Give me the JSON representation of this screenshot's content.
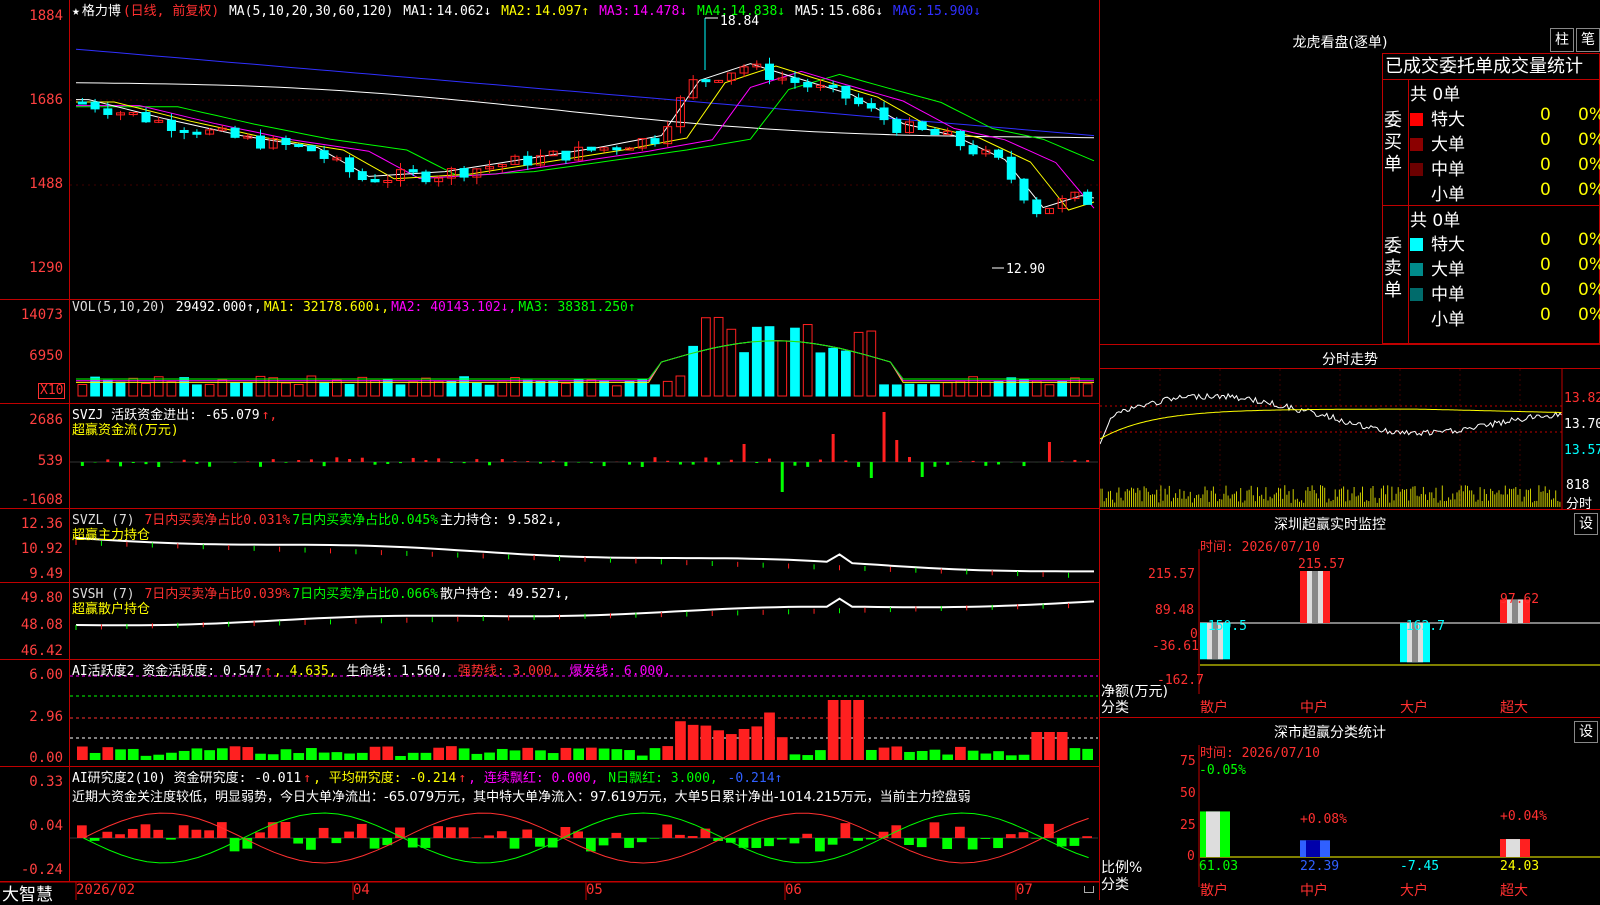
{
  "app_brand": "大智慧",
  "main_chart": {
    "stock": "格力博",
    "period": "(日线, 前复权)",
    "ma_params": "MA(5,10,20,30,60,120)",
    "ma": [
      {
        "label": "MA1:",
        "value": "14.062↓",
        "color": "#ffffff"
      },
      {
        "label": "MA2:",
        "value": "14.097↑",
        "color": "#ffff00"
      },
      {
        "label": "MA3:",
        "value": "14.478↓",
        "color": "#ff00ff"
      },
      {
        "label": "MA4:",
        "value": "14.838↓",
        "color": "#00ff00"
      },
      {
        "label": "MA5:",
        "value": "15.686↓",
        "color": "#ffffff"
      },
      {
        "label": "MA6:",
        "value": "15.900↓",
        "color": "#3030ff"
      }
    ],
    "y_ticks": [
      "1884",
      "1686",
      "1488",
      "1290"
    ],
    "high_label": "18.84",
    "low_label": "12.90"
  },
  "vol_panel": {
    "legend": [
      {
        "text": "VOL(5,10,20)",
        "color": "#ddd"
      },
      {
        "text": " 29492.000↑,",
        "color": "#fff"
      },
      {
        "text": "MA1: 32178.600↓,",
        "color": "#ffff00"
      },
      {
        "text": "MA2: 40143.102↓,",
        "color": "#ff00ff"
      },
      {
        "text": "MA3: 38381.250↑",
        "color": "#00ff00"
      }
    ],
    "y_ticks": [
      "14073",
      "6950"
    ],
    "unit": "X10"
  },
  "svzj_panel": {
    "legend1": [
      {
        "text": "SVZJ  活跃资金进出: -65.079",
        "color": "#fff"
      },
      {
        "text": "↑,",
        "color": "#ff3030"
      }
    ],
    "legend2": "超赢资金流(万元)",
    "y_ticks": [
      "2686",
      "539",
      "-1608"
    ]
  },
  "svzl_panel": {
    "legend1": [
      {
        "text": "SVZL (7) ",
        "color": "#ddd"
      },
      {
        "text": "7日内买卖净占比0.031%",
        "color": "#ff3030"
      },
      {
        "text": "7日内买卖净占比0.045%",
        "color": "#00ff00"
      },
      {
        "text": "主力持仓: 9.582↓,",
        "color": "#fff"
      }
    ],
    "legend2": "超赢主力持仓",
    "y_ticks": [
      "12.36",
      "10.92",
      "9.49"
    ]
  },
  "svsh_panel": {
    "legend1": [
      {
        "text": "SVSH (7) ",
        "color": "#ddd"
      },
      {
        "text": "7日内买卖净占比0.039%",
        "color": "#ff3030"
      },
      {
        "text": "7日内买卖净占比0.066%",
        "color": "#00ff00"
      },
      {
        "text": "散户持仓: 49.527↓,",
        "color": "#fff"
      }
    ],
    "legend2": "超赢散户持仓",
    "y_ticks": [
      "49.80",
      "48.08",
      "46.42"
    ]
  },
  "ai_active_panel": {
    "legend": [
      {
        "text": "AI活跃度2 资金活跃度: 0.547",
        "color": "#fff"
      },
      {
        "text": "↑",
        "color": "#ff3030"
      },
      {
        "text": ", 4.635,",
        "color": "#ffff00"
      },
      {
        "text": " 生命线: 1.560,",
        "color": "#fff"
      },
      {
        "text": " 强势线: 3.000,",
        "color": "#ff3030"
      },
      {
        "text": " 爆发线: 6.000,",
        "color": "#ff00ff"
      }
    ],
    "y_ticks": [
      "6.00",
      "2.96",
      "0.00"
    ]
  },
  "ai_research_panel": {
    "legend": [
      {
        "text": "AI研究度2(10) 资金研究度: -0.011",
        "color": "#fff"
      },
      {
        "text": "↑",
        "color": "#ff3030"
      },
      {
        "text": ", 平均研究度: -0.214",
        "color": "#ffff00"
      },
      {
        "text": "↑",
        "color": "#ff3030"
      },
      {
        "text": ", 连续飘红: 0.000,",
        "color": "#ff00ff"
      },
      {
        "text": " N日飘红: 3.000,",
        "color": "#00ff00"
      },
      {
        "text": " -0.214↑",
        "color": "#3060ff"
      }
    ],
    "commentary": "近期大资金关注度较低，明显弱势，今日大单净流出：-65.079万元，其中特大单净流入：97.619万元，大单5日累计净出-1014.215万元，当前主力控盘弱",
    "y_ticks": [
      "0.33",
      "0.04",
      "-0.24"
    ]
  },
  "date_axis": [
    "2026/02",
    "04",
    "05",
    "06",
    "07"
  ],
  "dragon_tiger": {
    "title": "龙虎看盘(逐单)",
    "btn_bar": "柱",
    "btn_pen": "笔",
    "tabs": "已成交委托单成交量统计",
    "buy": {
      "label": "委买单",
      "total": "共 0单",
      "rows": [
        {
          "name": "特大",
          "color": "#ff0000",
          "count": "0",
          "pct": "0%"
        },
        {
          "name": "大单",
          "color": "#8b0000",
          "count": "0",
          "pct": "0%"
        },
        {
          "name": "中单",
          "color": "#6b0000",
          "count": "0",
          "pct": "0%"
        },
        {
          "name": "小单",
          "color": "#000000",
          "count": "0",
          "pct": "0%"
        }
      ]
    },
    "sell": {
      "label": "委卖单",
      "total": "共 0单",
      "rows": [
        {
          "name": "特大",
          "color": "#00ffff",
          "count": "0",
          "pct": "0%"
        },
        {
          "name": "大单",
          "color": "#008b8b",
          "count": "0",
          "pct": "0%"
        },
        {
          "name": "中单",
          "color": "#006b6b",
          "count": "0",
          "pct": "0%"
        },
        {
          "name": "小单",
          "color": "#000000",
          "count": "0",
          "pct": "0%"
        }
      ]
    }
  },
  "intraday": {
    "title": "分时走势",
    "prices": [
      "13.82",
      "13.70",
      "13.57"
    ],
    "vol": "818",
    "vol_unit": "分时"
  },
  "monitor": {
    "title": "深圳超赢实时监控",
    "btn": "设",
    "time": "时间: 2026/07/10",
    "y_ticks": [
      "215.57",
      "89.48",
      "0",
      "-36.61",
      "-162.7"
    ],
    "axis_label1": "净额(万元)",
    "axis_label2": "分类",
    "categories": [
      "散户",
      "中户",
      "大户",
      "超大"
    ],
    "values": [
      -150.5,
      215.57,
      -162.7,
      97.62
    ],
    "value_labels": [
      "-150.5",
      "215.57",
      "-162.7",
      "97.62"
    ]
  },
  "classify": {
    "title": "深市超赢分类统计",
    "btn": "设",
    "time": "时间: 2026/07/10",
    "y_ticks": [
      "75",
      "50",
      "25",
      "0"
    ],
    "axis_label1": "比例%",
    "axis_label2": "分类",
    "categories": [
      "散户",
      "中户",
      "大户",
      "超大"
    ],
    "values": [
      61.03,
      22.39,
      -7.45,
      24.03
    ],
    "value_labels": [
      "61.03",
      "22.39",
      "-7.45",
      "24.03"
    ],
    "top_labels": [
      "-0.05%",
      "+0.08%",
      "",
      "+0.04%"
    ]
  },
  "colors": {
    "up": "#ff2020",
    "down": "#00ffff",
    "grid": "#c00000",
    "bg": "#000000"
  }
}
